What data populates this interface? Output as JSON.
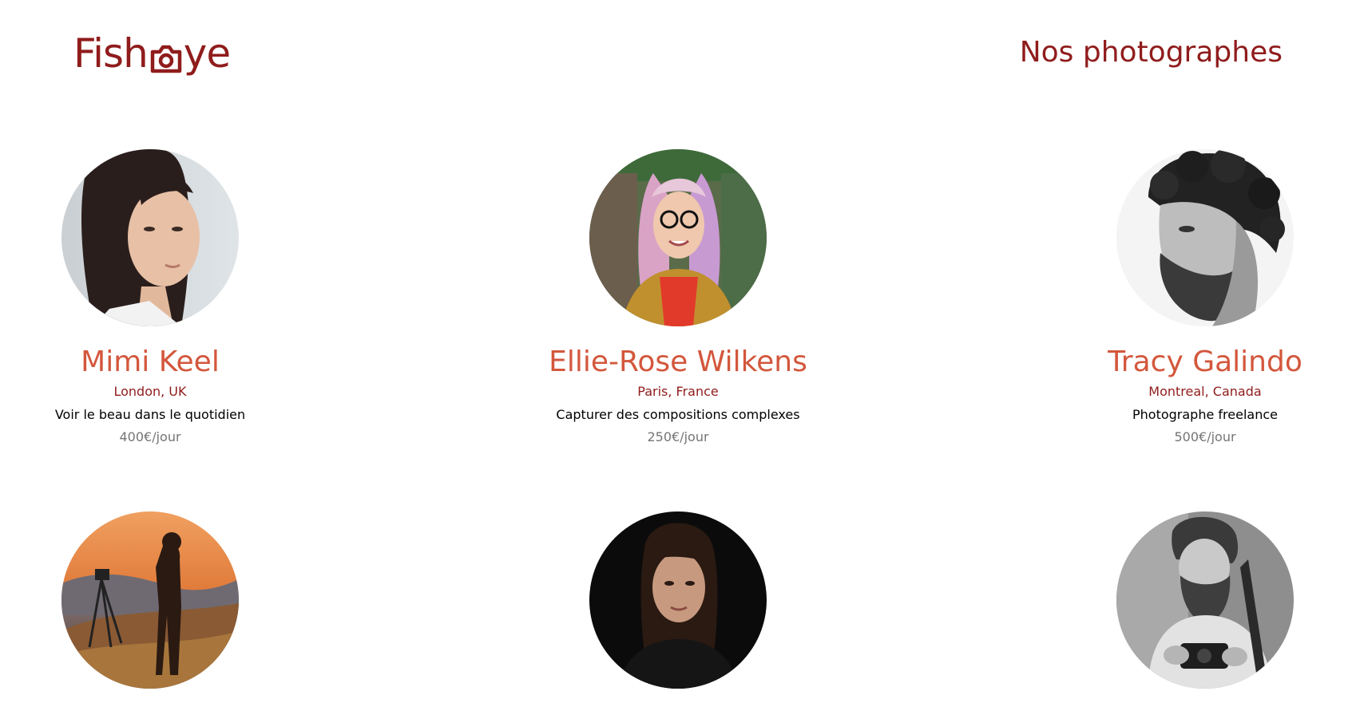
{
  "brand": {
    "logo_text_before": "Fish",
    "logo_text_after": "ye",
    "logo_icon": "camera-icon",
    "color": "#901c1c"
  },
  "header": {
    "title": "Nos photographes"
  },
  "colors": {
    "name": "#d3573c",
    "location": "#901c1c",
    "tagline": "#000000",
    "price": "#757575"
  },
  "photographers": [
    {
      "name": "Mimi Keel",
      "location": "London, UK",
      "tagline": "Voir le beau dans le quotidien",
      "price": "400€/jour",
      "portrait": "portrait-woman-dark-hair"
    },
    {
      "name": "Ellie-Rose Wilkens",
      "location": "Paris, France",
      "tagline": "Capturer des compositions complexes",
      "price": "250€/jour",
      "portrait": "portrait-woman-colorful-hair-glasses"
    },
    {
      "name": "Tracy Galindo",
      "location": "Montreal, Canada",
      "tagline": "Photographe freelance",
      "price": "500€/jour",
      "portrait": "portrait-man-curly-hair-bw"
    },
    {
      "portrait": "portrait-photographer-sunset-tripod"
    },
    {
      "portrait": "portrait-woman-dark-background"
    },
    {
      "portrait": "portrait-man-beard-camera-bw"
    }
  ]
}
